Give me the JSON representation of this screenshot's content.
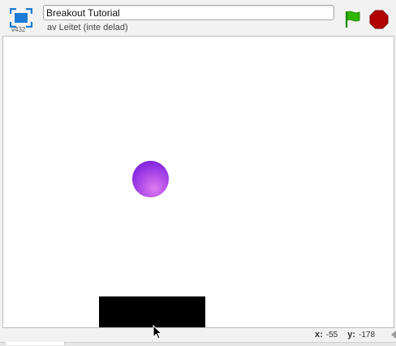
{
  "header": {
    "version": "v432",
    "title_value": "Breakout Tutorial",
    "author": "av Leitet (inte delad)"
  },
  "icons": {
    "fullscreen": "fullscreen-icon",
    "green_flag": "green-flag-icon",
    "stop": "stop-icon"
  },
  "colors": {
    "fullscreen_blue": "#1c7cd6",
    "flag_green": "#2fb800",
    "stop_red": "#b30000",
    "ball_purple": "#8a2be2",
    "paddle": "#000000"
  },
  "status": {
    "x_label": "x:",
    "x_value": "-55",
    "y_label": "y:",
    "y_value": "-178"
  }
}
